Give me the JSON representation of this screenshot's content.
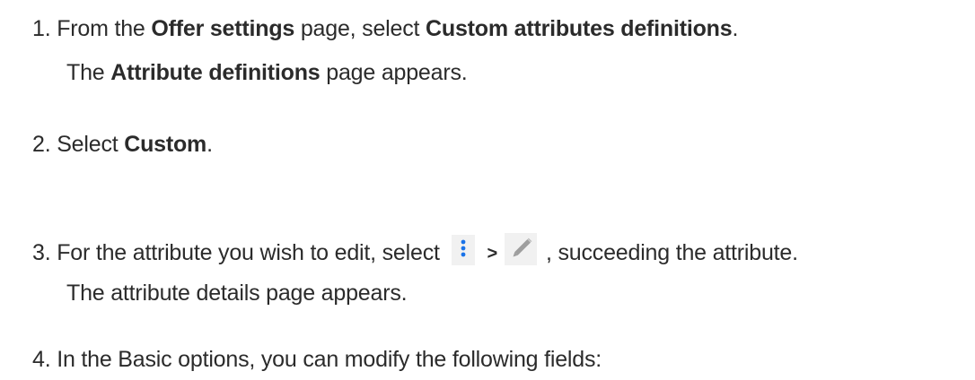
{
  "steps": [
    {
      "number": "1.",
      "parts": [
        "From the ",
        "Offer settings",
        " page, select ",
        "Custom attributes definitions",
        "."
      ],
      "result_parts": [
        "The ",
        "Attribute definitions",
        " page appears."
      ]
    },
    {
      "number": "2.",
      "parts": [
        "Select ",
        "Custom",
        "."
      ]
    },
    {
      "number": "3.",
      "parts": [
        "For the attribute you wish to edit, select",
        ">",
        ", succeeding the attribute."
      ],
      "result_text": "The attribute details page appears."
    },
    {
      "number": "4.",
      "text": "In the Basic options, you can modify the following fields:"
    }
  ],
  "icons": {
    "kebab": "more-vertical-icon",
    "kebab_color": "#1a73e8",
    "edit": "pencil-icon",
    "edit_color": "#9e9e9e"
  }
}
